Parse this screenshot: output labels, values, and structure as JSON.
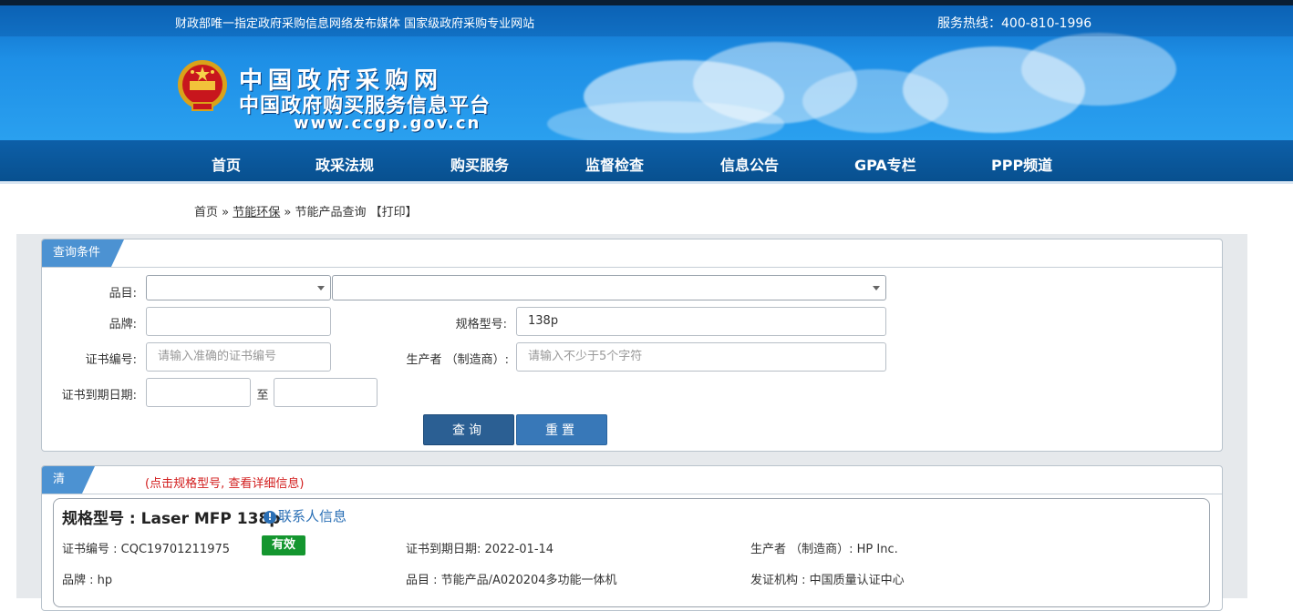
{
  "topbar": {
    "slogan": "财政部唯一指定政府采购信息网络发布媒体 国家级政府采购专业网站",
    "hotline": "服务热线：400-810-1996"
  },
  "brand": {
    "title": "中国政府采购网",
    "subtitle": "中国政府购买服务信息平台",
    "url": "www.ccgp.gov.cn"
  },
  "nav": [
    "首页",
    "政采法规",
    "购买服务",
    "监督检查",
    "信息公告",
    "GPA专栏",
    "PPP频道"
  ],
  "breadcrumb": {
    "home": "首页",
    "sep1": " » ",
    "section": "节能环保",
    "sep2": " » ",
    "page": "节能产品查询",
    "print": "【打印】"
  },
  "query": {
    "tab": "查询条件",
    "category_label": "品目:",
    "brand_label": "品牌:",
    "brand_value": "",
    "model_label": "规格型号:",
    "model_value": "138p",
    "cert_label": "证书编号:",
    "cert_placeholder": "请输入准确的证书编号",
    "maker_label": "生产者 （制造商）:",
    "maker_placeholder": "请输入不少于5个字符",
    "expiry_label": "证书到期日期:",
    "to_label": "至",
    "search_btn": "查询",
    "reset_btn": "重置"
  },
  "results": {
    "tab": "清单",
    "hint": "(点击规格型号, 查看详细信息)",
    "items": [
      {
        "title": "规格型号 : Laser MFP 138p",
        "contact": "联系人信息",
        "cert": "证书编号 : CQC19701211975",
        "status": "有效",
        "expiry": "证书到期日期: 2022-01-14",
        "maker": "生产者 （制造商）: HP Inc.",
        "brand": "品牌 : hp",
        "category": "品目 : 节能产品/A020204多功能一体机",
        "issuer": "发证机构 : 中国质量认证中心"
      }
    ]
  },
  "colors": {
    "nav_bg": "#0d5fa8",
    "tab_bg": "#4c92d2",
    "btn_query": "#2b5f93",
    "btn_reset": "#3878b8",
    "badge_valid": "#14962f",
    "hint_red": "#d21e1e"
  }
}
